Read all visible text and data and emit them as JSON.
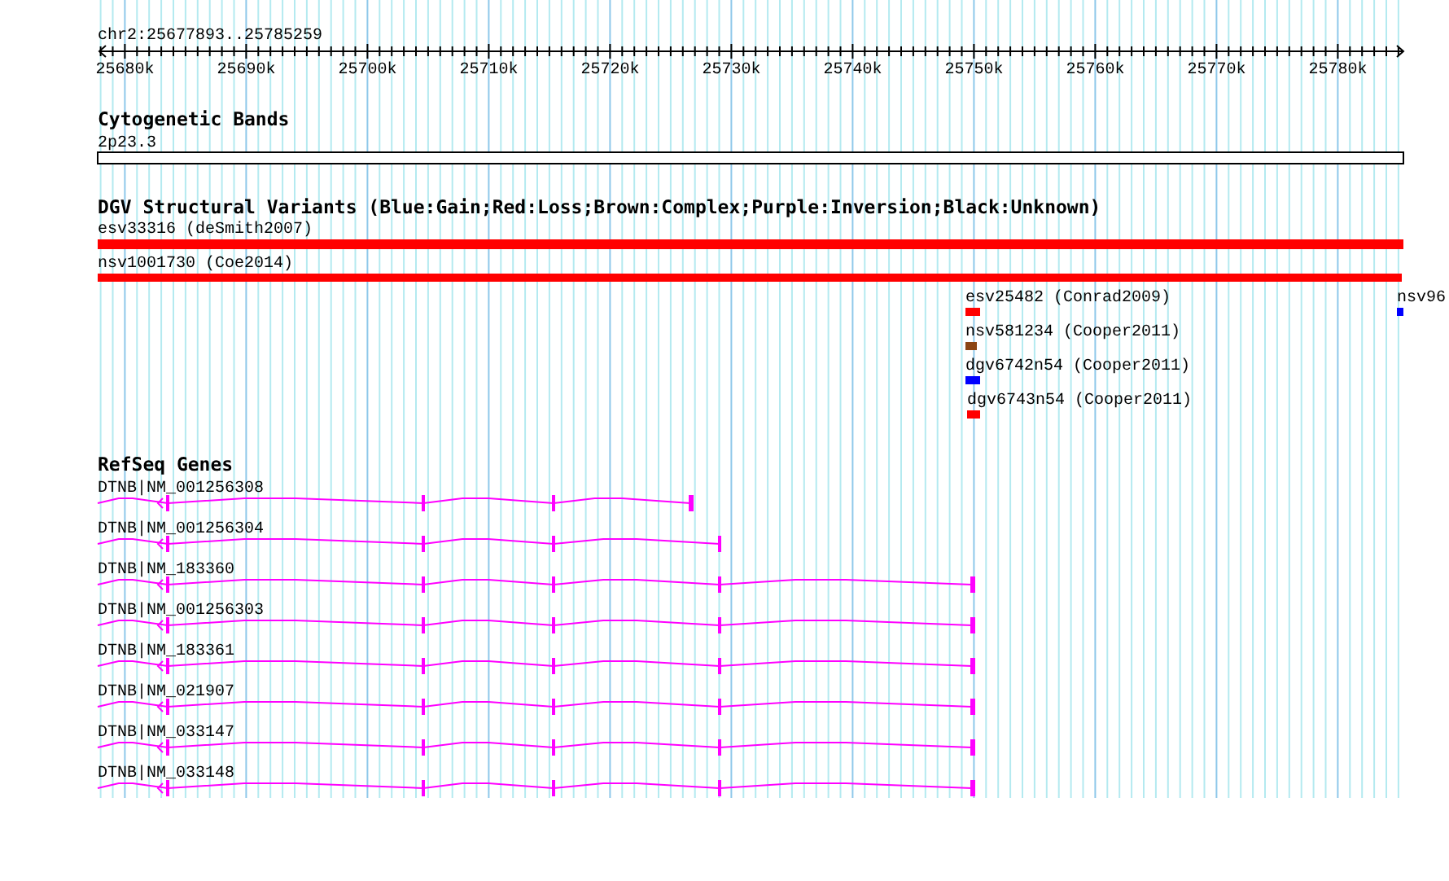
{
  "locus": "chr2:25677893..25785259",
  "axis_ticks": [
    "25680k",
    "25690k",
    "25700k",
    "25710k",
    "25720k",
    "25730k",
    "25740k",
    "25750k",
    "25760k",
    "25770k",
    "25780k"
  ],
  "tracks": [
    {
      "kind": "cytoband",
      "title": "Cytogenetic Bands",
      "features": [
        {
          "label": "2p23.3"
        }
      ]
    },
    {
      "kind": "variants",
      "title": "DGV Structural Variants (Blue:Gain;Red:Loss;Brown:Complex;Purple:Inversion;Black:Unknown)",
      "features": [
        {
          "label": "esv33316 (deSmith2007)",
          "color": "#ff0000"
        },
        {
          "label": "nsv1001730 (Coe2014)",
          "color": "#ff0000"
        },
        {
          "label": "esv25482 (Conrad2009)",
          "color": "#ff0000"
        },
        {
          "label": "nsv96",
          "color": "#0000ff"
        },
        {
          "label": "nsv581234 (Cooper2011)",
          "color": "#8b4513"
        },
        {
          "label": "dgv6742n54 (Cooper2011)",
          "color": "#0000ff"
        },
        {
          "label": "dgv6743n54 (Cooper2011)",
          "color": "#ff0000"
        }
      ]
    },
    {
      "kind": "genes",
      "title": "RefSeq Genes",
      "features": [
        {
          "label": "DTNB|NM_001256308"
        },
        {
          "label": "DTNB|NM_001256304"
        },
        {
          "label": "DTNB|NM_183360"
        },
        {
          "label": "DTNB|NM_001256303"
        },
        {
          "label": "DTNB|NM_183361"
        },
        {
          "label": "DTNB|NM_021907"
        },
        {
          "label": "DTNB|NM_033147"
        },
        {
          "label": "DTNB|NM_033148"
        }
      ]
    }
  ]
}
